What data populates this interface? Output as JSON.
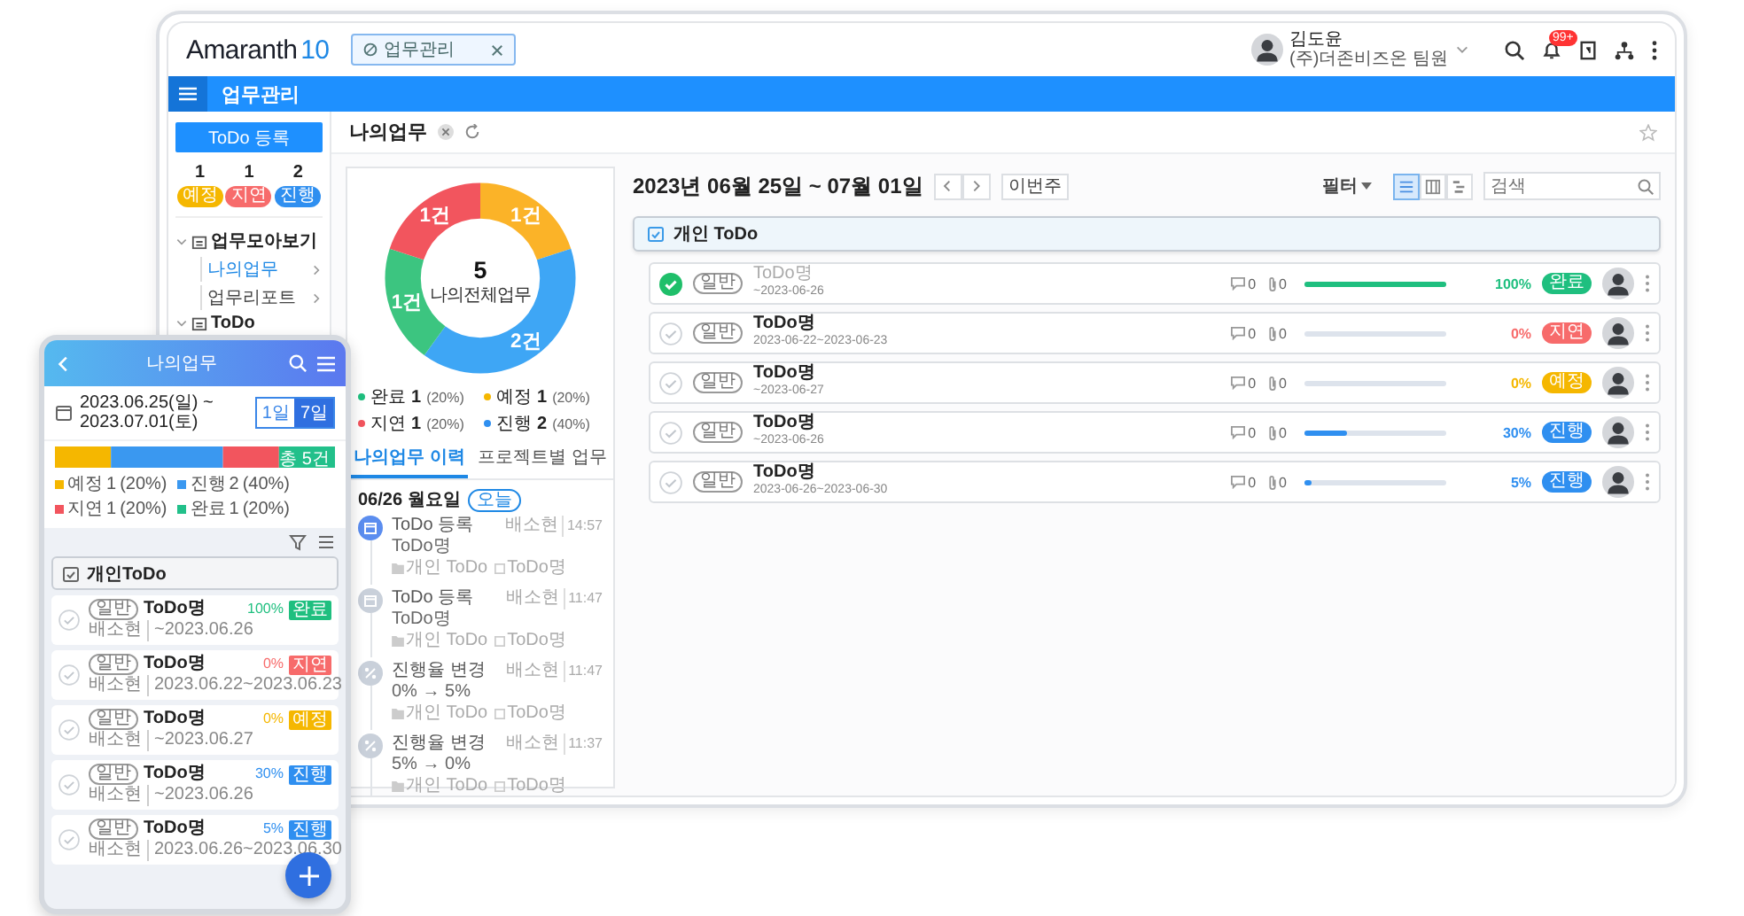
{
  "header": {
    "logo": {
      "name": "Amaranth",
      "version": "10"
    },
    "tab": {
      "label": "업무관리"
    },
    "user": {
      "name": "김도윤",
      "org": "(주)더존비즈온 팀원"
    },
    "notification_badge": "99+"
  },
  "nav_bar": {
    "title": "업무관리"
  },
  "sidebar": {
    "register_button": "ToDo 등록",
    "stats": [
      {
        "count": "1",
        "label": "예정",
        "color": "#f5b700"
      },
      {
        "count": "1",
        "label": "지연",
        "color": "#f76b6b"
      },
      {
        "count": "2",
        "label": "진행",
        "color": "#2f8ff0"
      }
    ],
    "tree": [
      {
        "label": "업무모아보기",
        "expanded": true,
        "children": [
          {
            "label": "나의업무",
            "selected": true
          },
          {
            "label": "업무리포트",
            "selected": false
          }
        ]
      },
      {
        "label": "ToDo",
        "expanded": true
      }
    ]
  },
  "page": {
    "title": "나의업무"
  },
  "summary": {
    "chart_data": {
      "type": "donut",
      "series": [
        {
          "values": [
            20,
            40,
            20,
            20
          ]
        }
      ],
      "colors": [
        "#fbb328",
        "#3ea6f5",
        "#3cc580",
        "#f2555e"
      ],
      "value_labels": [
        "1건",
        "2건",
        "1건",
        "1건"
      ]
    },
    "center_value": "5",
    "center_label": "나의전체업무",
    "legend": [
      {
        "label": "완료",
        "count": "1",
        "percent": "(20%)",
        "color": "#1fbf7f"
      },
      {
        "label": "예정",
        "count": "1",
        "percent": "(20%)",
        "color": "#f5b700"
      },
      {
        "label": "지연",
        "count": "1",
        "percent": "(20%)",
        "color": "#f2555e"
      },
      {
        "label": "진행",
        "count": "2",
        "percent": "(40%)",
        "color": "#2f8ff0"
      }
    ],
    "tabs": [
      {
        "label": "나의업무 이력",
        "selected": true
      },
      {
        "label": "프로젝트별 업무",
        "selected": false
      }
    ],
    "timeline": {
      "date": "06/26 월요일",
      "today_badge": "오늘",
      "entries": [
        {
          "kind": "register",
          "current": true,
          "action": "ToDo 등록",
          "author": "배소현",
          "time": "14:57",
          "detail": "ToDo명",
          "project": "개인 ToDo",
          "todo": "ToDo명"
        },
        {
          "kind": "register",
          "current": false,
          "action": "ToDo 등록",
          "author": "배소현",
          "time": "11:47",
          "detail": "ToDo명",
          "project": "개인 ToDo",
          "todo": "ToDo명"
        },
        {
          "kind": "progress",
          "current": false,
          "action": "진행율 변경",
          "author": "배소현",
          "time": "11:47",
          "detail": "0% → 5%",
          "project": "개인 ToDo",
          "todo": "ToDo명"
        },
        {
          "kind": "progress",
          "current": false,
          "action": "진행율 변경",
          "author": "배소현",
          "time": "11:37",
          "detail": "5% → 0%",
          "project": "개인 ToDo",
          "todo": "ToDo명"
        }
      ]
    }
  },
  "list": {
    "date_range": "2023년 06월 25일 ~ 07월 01일",
    "this_week_button": "이번주",
    "filter": "필터",
    "view_modes": [
      {
        "kind": "list",
        "selected": true
      },
      {
        "kind": "board",
        "selected": false
      },
      {
        "kind": "gantt",
        "selected": false
      }
    ],
    "search": {
      "placeholder": "검색"
    },
    "group": {
      "title": "개인 ToDo"
    },
    "rows": [
      {
        "done": true,
        "type_badge": "일반",
        "title": "ToDo명",
        "date": "~2023-06-26",
        "comments": "0",
        "attachments": "0",
        "level": 1,
        "percent": "100%",
        "status": "완료",
        "color": "#1fbf7f"
      },
      {
        "done": false,
        "type_badge": "일반",
        "title": "ToDo명",
        "date": "2023-06-22~2023-06-23",
        "comments": "0",
        "attachments": "0",
        "level": 0,
        "percent": "0%",
        "status": "지연",
        "color": "#f76b6b"
      },
      {
        "done": false,
        "type_badge": "일반",
        "title": "ToDo명",
        "date": "~2023-06-27",
        "comments": "0",
        "attachments": "0",
        "level": 0,
        "percent": "0%",
        "status": "예정",
        "color": "#f5b700"
      },
      {
        "done": false,
        "type_badge": "일반",
        "title": "ToDo명",
        "date": "~2023-06-26",
        "comments": "0",
        "attachments": "0",
        "level": 0.3,
        "percent": "30%",
        "status": "진행",
        "color": "#2f8ff0"
      },
      {
        "done": false,
        "type_badge": "일반",
        "title": "ToDo명",
        "date": "2023-06-26~2023-06-30",
        "comments": "0",
        "attachments": "0",
        "level": 0.05,
        "percent": "5%",
        "status": "진행",
        "color": "#2f8ff0"
      }
    ]
  },
  "mobile": {
    "title": "나의업무",
    "date_range": "2023.06.25(일) ~ 2023.07.01(토)",
    "ranges": [
      {
        "label": "1일",
        "selected": false
      },
      {
        "label": "7일",
        "selected": true
      }
    ],
    "bar_total": "총 5건",
    "legend": [
      {
        "label": "예정",
        "count": "1",
        "percent": "(20%)",
        "color": "#f5b700"
      },
      {
        "label": "진행",
        "count": "2",
        "percent": "(40%)",
        "color": "#3a98f0"
      },
      {
        "label": "지연",
        "count": "1",
        "percent": "(20%)",
        "color": "#f2555e"
      },
      {
        "label": "완료",
        "count": "1",
        "percent": "(20%)",
        "color": "#22c08a"
      }
    ],
    "group": "개인ToDo",
    "rows": [
      {
        "type_badge": "일반",
        "title": "ToDo명",
        "author": "배소현",
        "date": "~2023.06.26",
        "percent": "100%",
        "status": "완료",
        "color": "#1fbf7f"
      },
      {
        "type_badge": "일반",
        "title": "ToDo명",
        "author": "배소현",
        "date": "2023.06.22~2023.06.23",
        "percent": "0%",
        "status": "지연",
        "color": "#f76b6b"
      },
      {
        "type_badge": "일반",
        "title": "ToDo명",
        "author": "배소현",
        "date": "~2023.06.27",
        "percent": "0%",
        "status": "예정",
        "color": "#f5b700"
      },
      {
        "type_badge": "일반",
        "title": "ToDo명",
        "author": "배소현",
        "date": "~2023.06.26",
        "percent": "30%",
        "status": "진행",
        "color": "#2f8ff0"
      },
      {
        "type_badge": "일반",
        "title": "ToDo명",
        "author": "배소현",
        "date": "2023.06.26~2023.06.30",
        "percent": "5%",
        "status": "진행",
        "color": "#2f8ff0"
      }
    ]
  }
}
